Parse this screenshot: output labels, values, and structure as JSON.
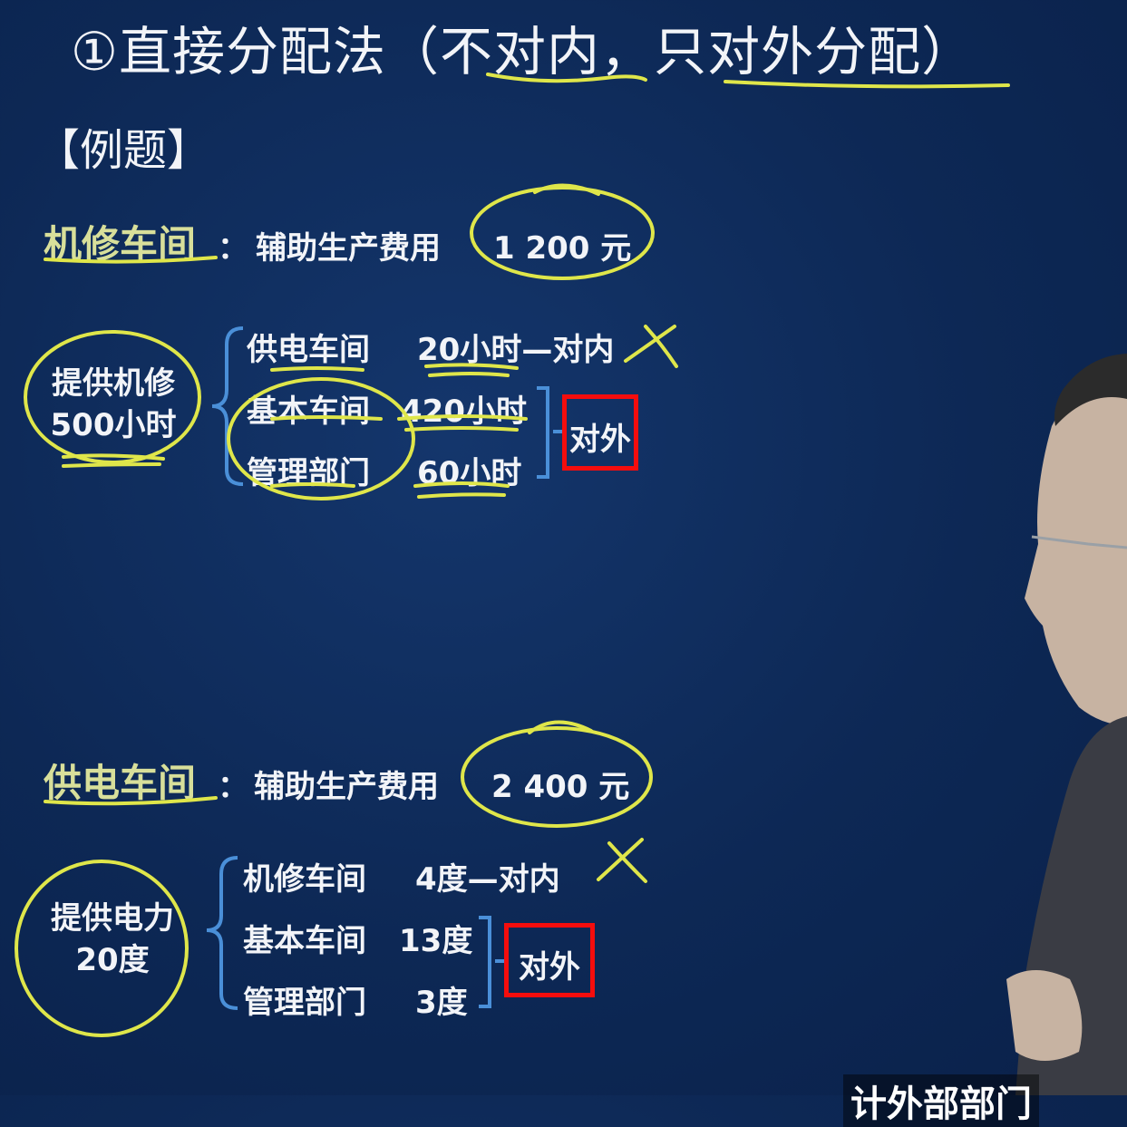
{
  "title": {
    "circled": "①",
    "main": "直接分配法",
    "open": "（",
    "part1": "不对内",
    "comma": "，",
    "part2": "只对外分配",
    "close": "）"
  },
  "example_label": "【例题】",
  "section1": {
    "dept": "机修车间",
    "colon": "：",
    "cost_label": "辅助生产费用",
    "cost_value": "1  200  元",
    "provide_line1": "提供机修",
    "provide_line2": "500小时",
    "rows": [
      {
        "name": "供电车间",
        "value": "20小时—对内"
      },
      {
        "name": "基本车间",
        "value": "420小时"
      },
      {
        "name": "管理部门",
        "value": "60小时"
      }
    ],
    "mark": "X",
    "outside_label": "对外"
  },
  "section2": {
    "dept": "供电车间",
    "colon": "：",
    "cost_label": "辅助生产费用",
    "cost_value": "2  400  元",
    "provide_line1": "提供电力",
    "provide_line2": "20度",
    "rows": [
      {
        "name": "机修车间",
        "value": "4度—对内"
      },
      {
        "name": "基本车间",
        "value": "13度"
      },
      {
        "name": "管理部门",
        "value": "3度"
      }
    ],
    "mark": "X",
    "outside_label": "对外"
  },
  "caption": "计外部部门",
  "colors": {
    "background": "#0d2855",
    "annotation": "#dfe64a",
    "highlight_box": "#f50d0d",
    "bracket": "#4a8fd8"
  }
}
